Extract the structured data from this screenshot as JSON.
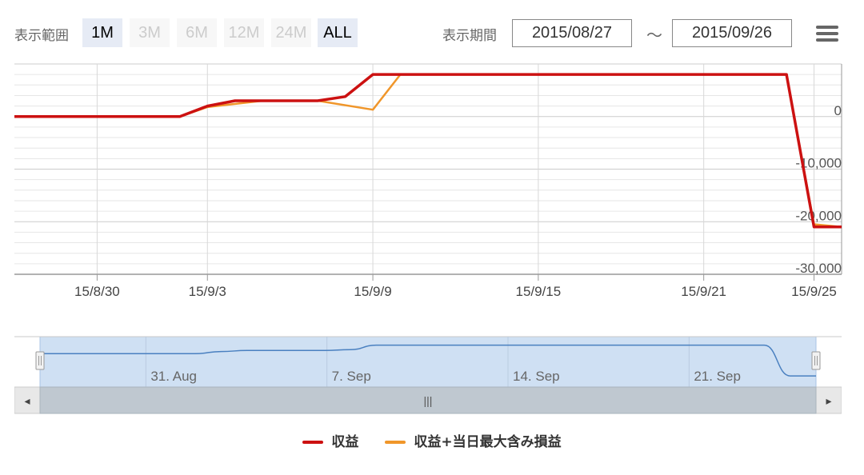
{
  "toolbar": {
    "range_label": "表示範囲",
    "range_buttons": [
      {
        "label": "1M",
        "active": true
      },
      {
        "label": "3M",
        "active": false
      },
      {
        "label": "6M",
        "active": false
      },
      {
        "label": "12M",
        "active": false
      },
      {
        "label": "24M",
        "active": false
      },
      {
        "label": "ALL",
        "active": true
      }
    ],
    "period_label": "表示期間",
    "from_date": "2015/08/27",
    "separator": "～",
    "to_date": "2015/09/26",
    "menu_icon": "hamburger-menu-icon"
  },
  "chart_data": {
    "type": "line",
    "x_range": [
      "2015-08-27",
      "2015-09-26"
    ],
    "x_tick_labels": [
      "15/8/30",
      "15/9/3",
      "15/9/9",
      "15/9/15",
      "15/9/21",
      "15/9/25"
    ],
    "x_tick_dates": [
      "2015-08-30",
      "2015-09-03",
      "2015-09-09",
      "2015-09-15",
      "2015-09-21",
      "2015-09-25"
    ],
    "y_tick_labels": [
      "0",
      "-10,000",
      "-20,000",
      "-30,000"
    ],
    "y_tick_values": [
      0,
      -10000,
      -20000,
      -30000
    ],
    "ylim": [
      -30000,
      10000
    ],
    "grid": true,
    "legend_position": "bottom-center",
    "series": [
      {
        "name": "収益",
        "color": "#cc1111",
        "points": [
          [
            "2015-08-27",
            0
          ],
          [
            "2015-09-02",
            0
          ],
          [
            "2015-09-03",
            2000
          ],
          [
            "2015-09-04",
            3000
          ],
          [
            "2015-09-06",
            3000
          ],
          [
            "2015-09-07",
            3000
          ],
          [
            "2015-09-08",
            3800
          ],
          [
            "2015-09-09",
            8000
          ],
          [
            "2015-09-24",
            8000
          ],
          [
            "2015-09-25",
            -21000
          ],
          [
            "2015-09-26",
            -21000
          ]
        ]
      },
      {
        "name": "収益+当日最大含み損益",
        "color": "#f0962a",
        "points": [
          [
            "2015-08-27",
            0
          ],
          [
            "2015-09-02",
            0
          ],
          [
            "2015-09-03",
            1800
          ],
          [
            "2015-09-05",
            3000
          ],
          [
            "2015-09-07",
            3000
          ],
          [
            "2015-09-09",
            1300
          ],
          [
            "2015-09-10",
            8000
          ],
          [
            "2015-09-24",
            8000
          ],
          [
            "2015-09-25",
            -20500
          ],
          [
            "2015-09-26",
            -21000
          ]
        ]
      }
    ]
  },
  "navigator": {
    "tick_labels": [
      "31. Aug",
      "7. Sep",
      "14. Sep",
      "21. Sep"
    ],
    "tick_dates": [
      "2015-08-31",
      "2015-09-07",
      "2015-09-14",
      "2015-09-21"
    ],
    "scroll_thumb_glyph": "|||",
    "left_arrow": "◂",
    "right_arrow": "▸"
  },
  "colors": {
    "grid": "#dddddd",
    "nav_fill": "#cfe0f3",
    "nav_line": "#4a80c0",
    "scrollbar_track": "#eeeeee",
    "scrollbar_thumb": "#bfc8d0"
  }
}
